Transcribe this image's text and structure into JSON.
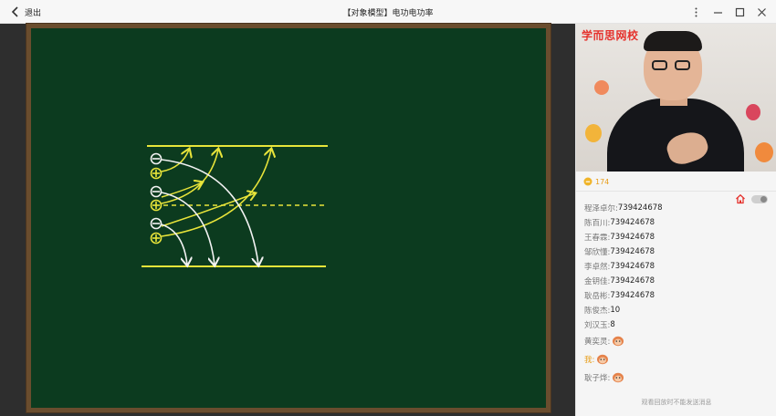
{
  "titlebar": {
    "back_label": "退出",
    "title": "【对象模型】电功电功率"
  },
  "video": {
    "logo_text": "学而思网校"
  },
  "stats": {
    "likes": "174"
  },
  "chat": {
    "messages": [
      {
        "name": "程泽卓尔:",
        "text": "739424678"
      },
      {
        "name": "陈百川:",
        "text": "739424678"
      },
      {
        "name": "王春霖:",
        "text": "739424678"
      },
      {
        "name": "邹欣懂:",
        "text": "739424678"
      },
      {
        "name": "李卓然:",
        "text": "739424678"
      },
      {
        "name": "金钥佳:",
        "text": "739424678"
      },
      {
        "name": "耿岳彬:",
        "text": "739424678"
      },
      {
        "name": "陈俊杰:",
        "text": "10"
      },
      {
        "name": "刘汉玉:",
        "text": "8"
      },
      {
        "name": "黄奕灵:",
        "text": "",
        "emoji": "monkey-face"
      },
      {
        "name": "我:",
        "text": "",
        "emoji": "monkey-face"
      },
      {
        "name": "耿子烨:",
        "text": "",
        "emoji": "monkey-face"
      }
    ],
    "notice": "观看回放时不能发送消息"
  },
  "colors": {
    "board": "#0c3b1f",
    "frame": "#6a4d2e",
    "chalk_yellow": "#e8e43a",
    "chalk_white": "#f2f2f2",
    "accent_orange": "#e89e1a",
    "brand_red": "#e5322d"
  },
  "icons": [
    "chevron-left-icon",
    "more-vertical-icon",
    "minimize-icon",
    "maximize-icon",
    "close-icon",
    "like-icon",
    "home-icon",
    "toggle-switch",
    "monkey-face-icon"
  ]
}
